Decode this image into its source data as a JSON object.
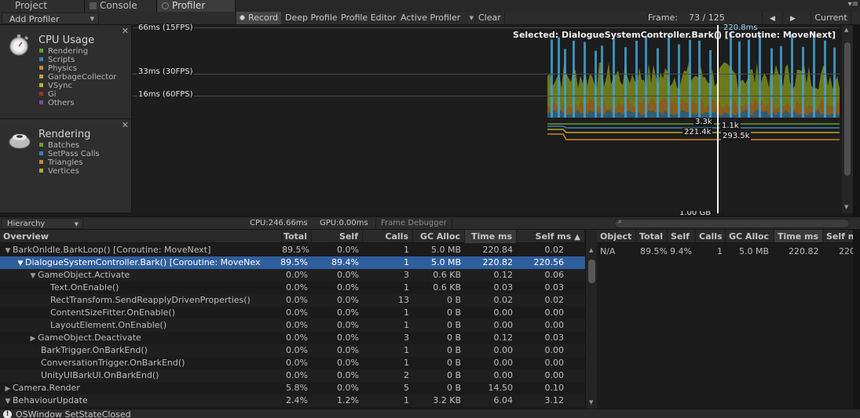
{
  "tabs": [
    {
      "label": "Project",
      "active": false
    },
    {
      "label": "Console",
      "active": false
    },
    {
      "label": "Profiler",
      "active": true
    }
  ],
  "toolbar": {
    "add_profiler": "Add Profiler",
    "record": "Record",
    "deep_profile": "Deep Profile",
    "profile_editor": "Profile Editor",
    "active_profiler": "Active Profiler",
    "clear": "Clear",
    "frame_label": "Frame:",
    "frame_value": "73 / 125",
    "current": "Current",
    "prev_icon": "arrow-left-icon",
    "next_icon": "arrow-right-icon"
  },
  "cpu_area": {
    "title": "CPU Usage",
    "icon": "stopwatch-icon",
    "legend": [
      {
        "label": "Rendering",
        "color": "#6b9e28"
      },
      {
        "label": "Scripts",
        "color": "#3a7fb5"
      },
      {
        "label": "Physics",
        "color": "#c8872a"
      },
      {
        "label": "GarbageCollector",
        "color": "#b8a535"
      },
      {
        "label": "VSync",
        "color": "#b5b530"
      },
      {
        "label": "Gi",
        "color": "#9a3428"
      },
      {
        "label": "Others",
        "color": "#7a4ca0"
      }
    ],
    "lines": [
      {
        "label": "66ms (15FPS)"
      },
      {
        "label": "33ms (30FPS)"
      },
      {
        "label": "16ms (60FPS)"
      }
    ],
    "selected": "Selected: DialogueSystemController.Bark() [Coroutine: MoveNext]",
    "top_value": "220.8ms"
  },
  "render_area": {
    "title": "Rendering",
    "icon": "teapot-icon",
    "legend": [
      {
        "label": "Batches",
        "color": "#6b9e28"
      },
      {
        "label": "SetPass Calls",
        "color": "#3a7fb5"
      },
      {
        "label": "Triangles",
        "color": "#c8872a"
      },
      {
        "label": "Vertices",
        "color": "#b8a535"
      }
    ],
    "values": [
      "3.3k",
      "1.1k",
      "221.4k",
      "293.5k",
      "1.00 GB"
    ]
  },
  "subtoolbar": {
    "view_mode": "Hierarchy",
    "cpu": "CPU:246.66ms",
    "gpu": "GPU:0.00ms",
    "frame_debugger": "Frame Debugger"
  },
  "hierarchy": {
    "columns": [
      "Overview",
      "Total",
      "Self",
      "Calls",
      "GC Alloc",
      "Time ms",
      "Self ms"
    ],
    "rows": [
      {
        "depth": 0,
        "fold": "open",
        "name": "BarkOnIdle.BarkLoop() [Coroutine: MoveNext]",
        "total": "89.5%",
        "self": "0.0%",
        "calls": "1",
        "gc": "5.0 MB",
        "time": "220.84",
        "selfms": "0.02"
      },
      {
        "depth": 1,
        "fold": "open",
        "name": "DialogueSystemController.Bark() [Coroutine: MoveNext]",
        "total": "89.5%",
        "self": "89.4%",
        "calls": "1",
        "gc": "5.0 MB",
        "time": "220.82",
        "selfms": "220.56",
        "selected": true
      },
      {
        "depth": 2,
        "fold": "open",
        "name": "GameObject.Activate",
        "total": "0.0%",
        "self": "0.0%",
        "calls": "3",
        "gc": "0.6 KB",
        "time": "0.12",
        "selfms": "0.06"
      },
      {
        "depth": 3,
        "fold": "",
        "name": "Text.OnEnable()",
        "total": "0.0%",
        "self": "0.0%",
        "calls": "1",
        "gc": "0.6 KB",
        "time": "0.03",
        "selfms": "0.03"
      },
      {
        "depth": 3,
        "fold": "",
        "name": "RectTransform.SendReapplyDrivenProperties()",
        "total": "0.0%",
        "self": "0.0%",
        "calls": "13",
        "gc": "0 B",
        "time": "0.02",
        "selfms": "0.02"
      },
      {
        "depth": 3,
        "fold": "",
        "name": "ContentSizeFitter.OnEnable()",
        "total": "0.0%",
        "self": "0.0%",
        "calls": "1",
        "gc": "0 B",
        "time": "0.00",
        "selfms": "0.00"
      },
      {
        "depth": 3,
        "fold": "",
        "name": "LayoutElement.OnEnable()",
        "total": "0.0%",
        "self": "0.0%",
        "calls": "1",
        "gc": "0 B",
        "time": "0.00",
        "selfms": "0.00"
      },
      {
        "depth": 2,
        "fold": "closed",
        "name": "GameObject.Deactivate",
        "total": "0.0%",
        "self": "0.0%",
        "calls": "3",
        "gc": "0 B",
        "time": "0.12",
        "selfms": "0.03"
      },
      {
        "depth": 2,
        "fold": "",
        "name": "BarkTrigger.OnBarkEnd()",
        "total": "0.0%",
        "self": "0.0%",
        "calls": "1",
        "gc": "0 B",
        "time": "0.00",
        "selfms": "0.00"
      },
      {
        "depth": 2,
        "fold": "",
        "name": "ConversationTrigger.OnBarkEnd()",
        "total": "0.0%",
        "self": "0.0%",
        "calls": "1",
        "gc": "0 B",
        "time": "0.00",
        "selfms": "0.00"
      },
      {
        "depth": 2,
        "fold": "",
        "name": "UnityUIBarkUI.OnBarkEnd()",
        "total": "0.0%",
        "self": "0.0%",
        "calls": "2",
        "gc": "0 B",
        "time": "0.00",
        "selfms": "0.00"
      },
      {
        "depth": 0,
        "fold": "closed",
        "name": "Camera.Render",
        "total": "5.8%",
        "self": "0.0%",
        "calls": "5",
        "gc": "0 B",
        "time": "14.50",
        "selfms": "0.10"
      },
      {
        "depth": 0,
        "fold": "open",
        "name": "BehaviourUpdate",
        "total": "2.4%",
        "self": "1.2%",
        "calls": "1",
        "gc": "3.2 KB",
        "time": "6.04",
        "selfms": "3.12"
      }
    ]
  },
  "details": {
    "columns": [
      "Object",
      "Total",
      "Self",
      "Calls",
      "GC Alloc",
      "Time ms",
      "Self ms"
    ],
    "row": [
      "N/A",
      "89.5%",
      "9.4%",
      "1",
      "5.0 MB",
      "220.82",
      "220."
    ]
  },
  "status": {
    "icon": "info-icon",
    "text": "OSWindow SetStateClosed"
  }
}
